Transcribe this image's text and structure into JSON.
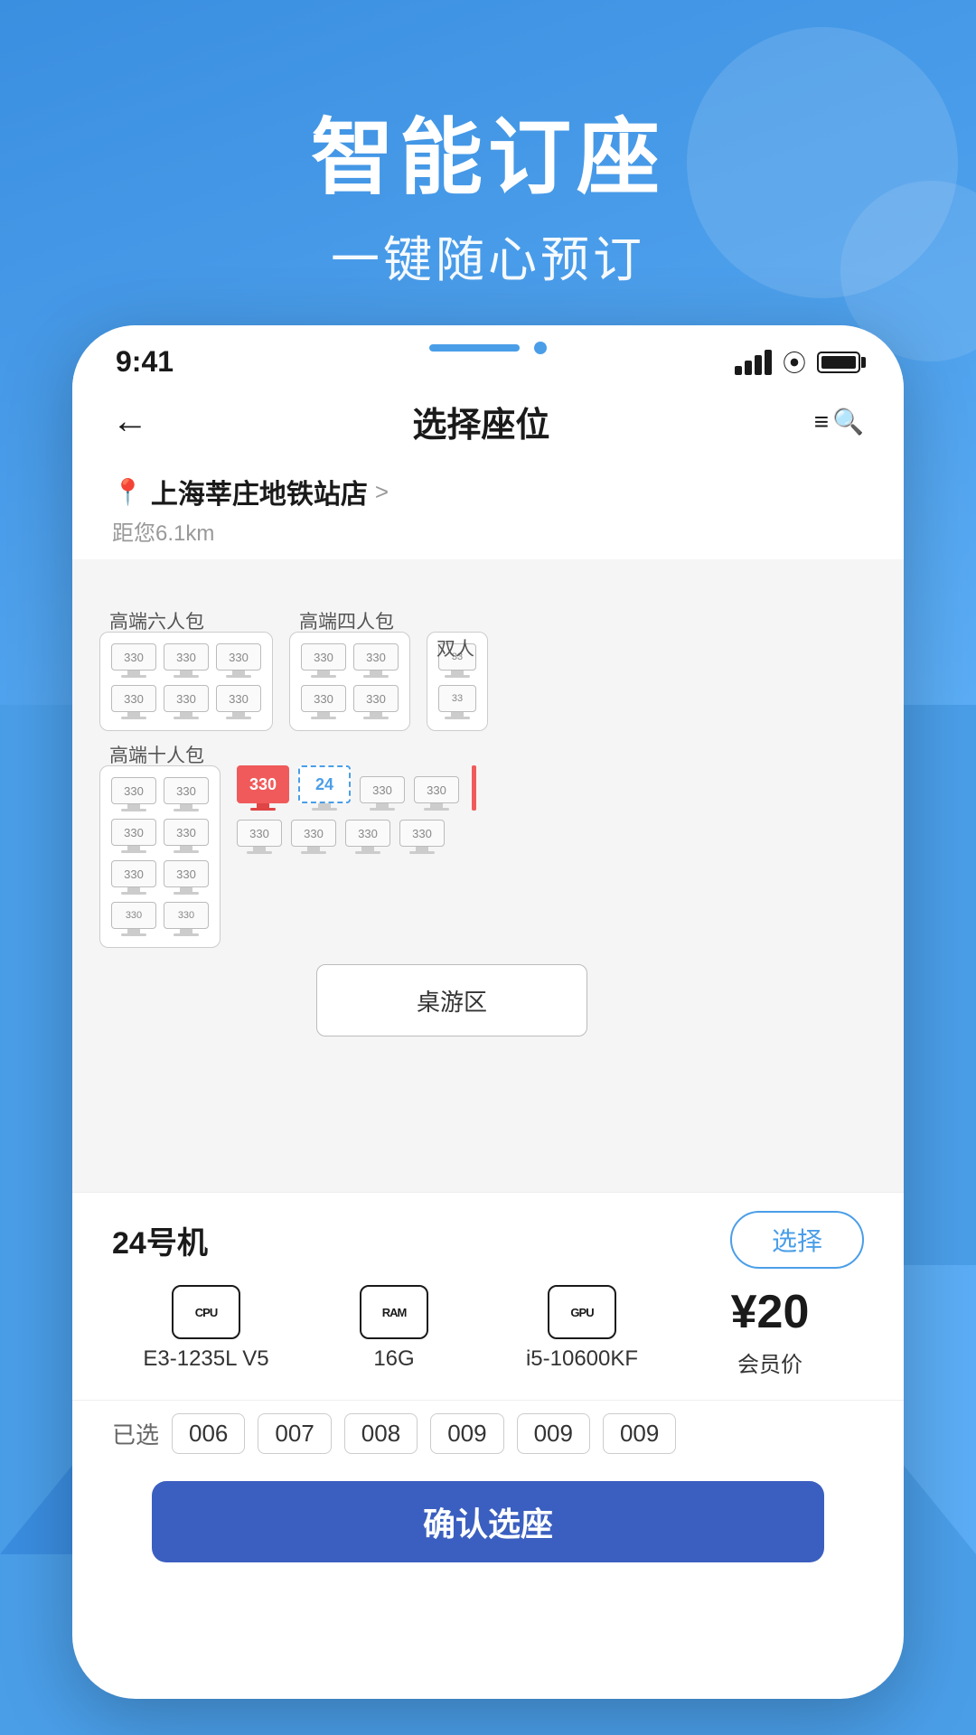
{
  "app": {
    "header_main": "智能订座",
    "header_sub": "一键随心预订"
  },
  "status_bar": {
    "time": "9:41",
    "signal": "signal",
    "wifi": "wifi",
    "battery": "battery"
  },
  "nav": {
    "back": "←",
    "title": "选择座位",
    "search_icon": "search"
  },
  "location": {
    "name": "上海莘庄地铁站店",
    "distance": "距您6.1km",
    "arrow": ">"
  },
  "seat_map": {
    "rooms": [
      {
        "label": "高端六人包",
        "cols": 3,
        "rows": 2,
        "price": 330
      },
      {
        "label": "高端四人包",
        "cols": 2,
        "rows": 2,
        "price": 330
      },
      {
        "label": "高端双人包",
        "cols": 1,
        "rows": 2,
        "price": 33
      }
    ],
    "bottom_room": {
      "label": "高端十人包",
      "cols": 2,
      "rows": 3
    },
    "selected_seat_num": "24",
    "price_per_seat": 330,
    "board_game_label": "桌游区"
  },
  "machine_info": {
    "name": "24号机",
    "choose_label": "选择",
    "cpu_icon": "CPU",
    "cpu_label": "E3-1235L V5",
    "ram_icon": "RAM",
    "ram_label": "16G",
    "gpu_icon": "GPU",
    "gpu_label": "i5-10600KF",
    "price": "¥20",
    "price_label": "会员价"
  },
  "selected_seats": {
    "label": "已选",
    "seats": [
      "006",
      "007",
      "008",
      "009",
      "009",
      "009"
    ]
  },
  "confirm_button": "确认选座"
}
